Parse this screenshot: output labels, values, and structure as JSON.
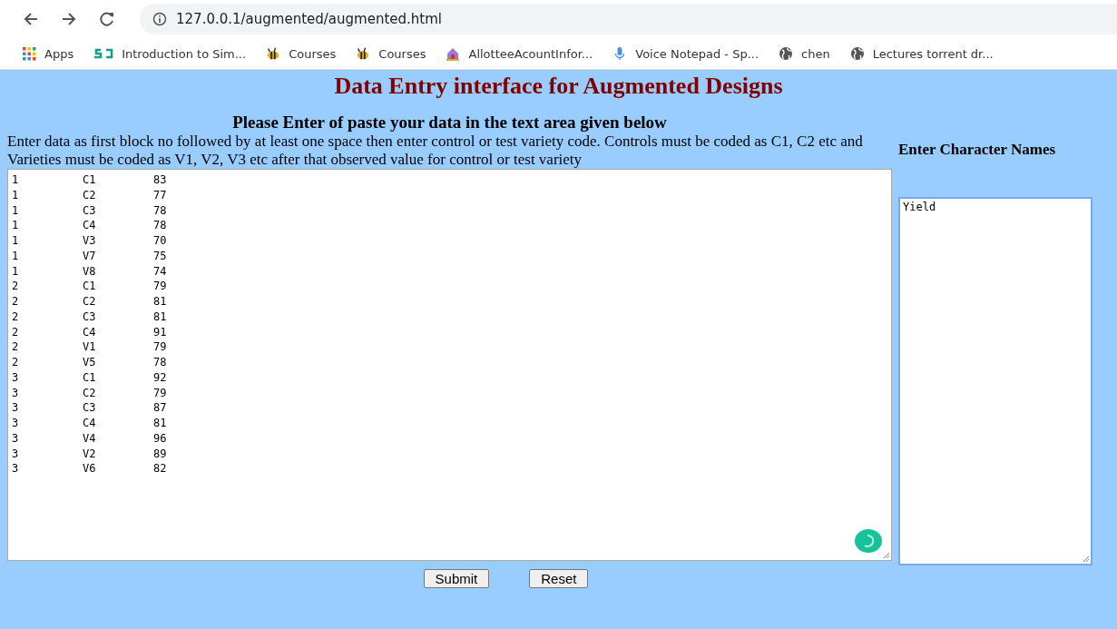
{
  "browser": {
    "url": "127.0.0.1/augmented/augmented.html"
  },
  "bookmarks": [
    {
      "label": "Apps",
      "kind": "apps"
    },
    {
      "label": "Introduction to Sim...",
      "kind": "sj"
    },
    {
      "label": "Courses",
      "kind": "bee"
    },
    {
      "label": "Courses",
      "kind": "bee"
    },
    {
      "label": "AllotteeAcountInfor...",
      "kind": "house"
    },
    {
      "label": "Voice Notepad - Sp...",
      "kind": "mic"
    },
    {
      "label": "chen",
      "kind": "globe"
    },
    {
      "label": "Lectures torrent dr...",
      "kind": "globe"
    }
  ],
  "page": {
    "title": "Data Entry interface for Augmented Designs",
    "subtitle": "Please Enter of paste your data in the text area given below",
    "instructions": "Enter data as first block no followed by at least one space then enter control or test variety code. Controls must be coded as C1, C2 etc and Varieties must be  coded as V1, V2, V3 etc after that observed value for control or test variety",
    "character_heading": "Enter Character Names"
  },
  "data_rows": [
    [
      "1",
      "C1",
      "83"
    ],
    [
      "1",
      "C2",
      "77"
    ],
    [
      "1",
      "C3",
      "78"
    ],
    [
      "1",
      "C4",
      "78"
    ],
    [
      "1",
      "V3",
      "70"
    ],
    [
      "1",
      "V7",
      "75"
    ],
    [
      "1",
      "V8",
      "74"
    ],
    [
      "2",
      "C1",
      "79"
    ],
    [
      "2",
      "C2",
      "81"
    ],
    [
      "2",
      "C3",
      "81"
    ],
    [
      "2",
      "C4",
      "91"
    ],
    [
      "2",
      "V1",
      "79"
    ],
    [
      "2",
      "V5",
      "78"
    ],
    [
      "3",
      "C1",
      "92"
    ],
    [
      "3",
      "C2",
      "79"
    ],
    [
      "3",
      "C3",
      "87"
    ],
    [
      "3",
      "C4",
      "81"
    ],
    [
      "3",
      "V4",
      "96"
    ],
    [
      "3",
      "V2",
      "89"
    ],
    [
      "3",
      "V6",
      "82"
    ]
  ],
  "character_names": [
    "Yield"
  ],
  "buttons": [
    "Submit",
    "Reset"
  ]
}
